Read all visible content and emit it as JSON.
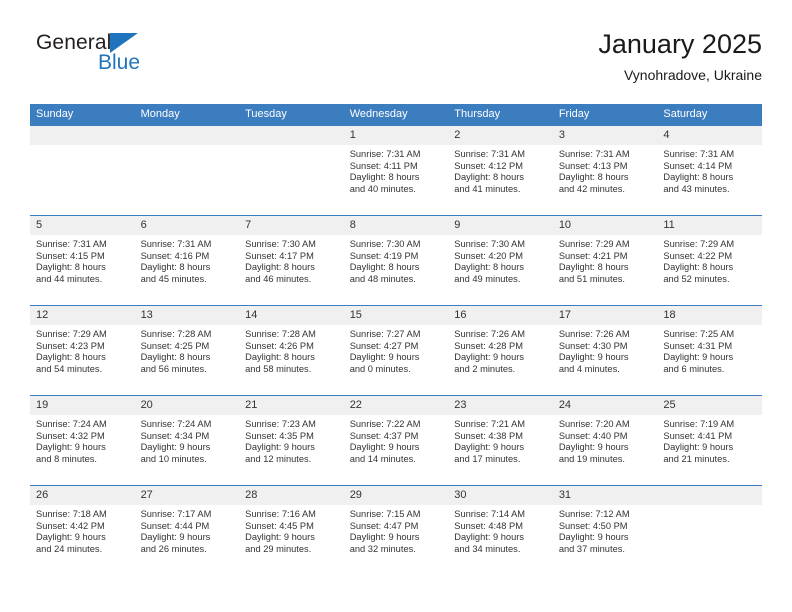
{
  "brand": {
    "name_top": "General",
    "name_bottom": "Blue",
    "triangle_color": "#1f74bd",
    "logo_icon": "general-blue-logo"
  },
  "header": {
    "title": "January 2025",
    "subtitle": "Vynohradove, Ukraine"
  },
  "theme": {
    "header_bg": "#3c7dc0",
    "header_text": "#ffffff",
    "daynum_bg": "#f0f0f0",
    "cell_bg": "#ffffff",
    "rule_color": "#3c7dc0",
    "body_text": "#333333"
  },
  "weekdays": [
    "Sunday",
    "Monday",
    "Tuesday",
    "Wednesday",
    "Thursday",
    "Friday",
    "Saturday"
  ],
  "labels": {
    "sunrise_prefix": "Sunrise:",
    "sunset_prefix": "Sunset:",
    "daylight_prefix": "Daylight:"
  },
  "weeks": [
    [
      {
        "blank": true
      },
      {
        "blank": true
      },
      {
        "blank": true
      },
      {
        "day": "1",
        "sunrise": "Sunrise: 7:31 AM",
        "sunset": "Sunset: 4:11 PM",
        "daylight1": "Daylight: 8 hours",
        "daylight2": "and 40 minutes."
      },
      {
        "day": "2",
        "sunrise": "Sunrise: 7:31 AM",
        "sunset": "Sunset: 4:12 PM",
        "daylight1": "Daylight: 8 hours",
        "daylight2": "and 41 minutes."
      },
      {
        "day": "3",
        "sunrise": "Sunrise: 7:31 AM",
        "sunset": "Sunset: 4:13 PM",
        "daylight1": "Daylight: 8 hours",
        "daylight2": "and 42 minutes."
      },
      {
        "day": "4",
        "sunrise": "Sunrise: 7:31 AM",
        "sunset": "Sunset: 4:14 PM",
        "daylight1": "Daylight: 8 hours",
        "daylight2": "and 43 minutes."
      }
    ],
    [
      {
        "day": "5",
        "sunrise": "Sunrise: 7:31 AM",
        "sunset": "Sunset: 4:15 PM",
        "daylight1": "Daylight: 8 hours",
        "daylight2": "and 44 minutes."
      },
      {
        "day": "6",
        "sunrise": "Sunrise: 7:31 AM",
        "sunset": "Sunset: 4:16 PM",
        "daylight1": "Daylight: 8 hours",
        "daylight2": "and 45 minutes."
      },
      {
        "day": "7",
        "sunrise": "Sunrise: 7:30 AM",
        "sunset": "Sunset: 4:17 PM",
        "daylight1": "Daylight: 8 hours",
        "daylight2": "and 46 minutes."
      },
      {
        "day": "8",
        "sunrise": "Sunrise: 7:30 AM",
        "sunset": "Sunset: 4:19 PM",
        "daylight1": "Daylight: 8 hours",
        "daylight2": "and 48 minutes."
      },
      {
        "day": "9",
        "sunrise": "Sunrise: 7:30 AM",
        "sunset": "Sunset: 4:20 PM",
        "daylight1": "Daylight: 8 hours",
        "daylight2": "and 49 minutes."
      },
      {
        "day": "10",
        "sunrise": "Sunrise: 7:29 AM",
        "sunset": "Sunset: 4:21 PM",
        "daylight1": "Daylight: 8 hours",
        "daylight2": "and 51 minutes."
      },
      {
        "day": "11",
        "sunrise": "Sunrise: 7:29 AM",
        "sunset": "Sunset: 4:22 PM",
        "daylight1": "Daylight: 8 hours",
        "daylight2": "and 52 minutes."
      }
    ],
    [
      {
        "day": "12",
        "sunrise": "Sunrise: 7:29 AM",
        "sunset": "Sunset: 4:23 PM",
        "daylight1": "Daylight: 8 hours",
        "daylight2": "and 54 minutes."
      },
      {
        "day": "13",
        "sunrise": "Sunrise: 7:28 AM",
        "sunset": "Sunset: 4:25 PM",
        "daylight1": "Daylight: 8 hours",
        "daylight2": "and 56 minutes."
      },
      {
        "day": "14",
        "sunrise": "Sunrise: 7:28 AM",
        "sunset": "Sunset: 4:26 PM",
        "daylight1": "Daylight: 8 hours",
        "daylight2": "and 58 minutes."
      },
      {
        "day": "15",
        "sunrise": "Sunrise: 7:27 AM",
        "sunset": "Sunset: 4:27 PM",
        "daylight1": "Daylight: 9 hours",
        "daylight2": "and 0 minutes."
      },
      {
        "day": "16",
        "sunrise": "Sunrise: 7:26 AM",
        "sunset": "Sunset: 4:28 PM",
        "daylight1": "Daylight: 9 hours",
        "daylight2": "and 2 minutes."
      },
      {
        "day": "17",
        "sunrise": "Sunrise: 7:26 AM",
        "sunset": "Sunset: 4:30 PM",
        "daylight1": "Daylight: 9 hours",
        "daylight2": "and 4 minutes."
      },
      {
        "day": "18",
        "sunrise": "Sunrise: 7:25 AM",
        "sunset": "Sunset: 4:31 PM",
        "daylight1": "Daylight: 9 hours",
        "daylight2": "and 6 minutes."
      }
    ],
    [
      {
        "day": "19",
        "sunrise": "Sunrise: 7:24 AM",
        "sunset": "Sunset: 4:32 PM",
        "daylight1": "Daylight: 9 hours",
        "daylight2": "and 8 minutes."
      },
      {
        "day": "20",
        "sunrise": "Sunrise: 7:24 AM",
        "sunset": "Sunset: 4:34 PM",
        "daylight1": "Daylight: 9 hours",
        "daylight2": "and 10 minutes."
      },
      {
        "day": "21",
        "sunrise": "Sunrise: 7:23 AM",
        "sunset": "Sunset: 4:35 PM",
        "daylight1": "Daylight: 9 hours",
        "daylight2": "and 12 minutes."
      },
      {
        "day": "22",
        "sunrise": "Sunrise: 7:22 AM",
        "sunset": "Sunset: 4:37 PM",
        "daylight1": "Daylight: 9 hours",
        "daylight2": "and 14 minutes."
      },
      {
        "day": "23",
        "sunrise": "Sunrise: 7:21 AM",
        "sunset": "Sunset: 4:38 PM",
        "daylight1": "Daylight: 9 hours",
        "daylight2": "and 17 minutes."
      },
      {
        "day": "24",
        "sunrise": "Sunrise: 7:20 AM",
        "sunset": "Sunset: 4:40 PM",
        "daylight1": "Daylight: 9 hours",
        "daylight2": "and 19 minutes."
      },
      {
        "day": "25",
        "sunrise": "Sunrise: 7:19 AM",
        "sunset": "Sunset: 4:41 PM",
        "daylight1": "Daylight: 9 hours",
        "daylight2": "and 21 minutes."
      }
    ],
    [
      {
        "day": "26",
        "sunrise": "Sunrise: 7:18 AM",
        "sunset": "Sunset: 4:42 PM",
        "daylight1": "Daylight: 9 hours",
        "daylight2": "and 24 minutes."
      },
      {
        "day": "27",
        "sunrise": "Sunrise: 7:17 AM",
        "sunset": "Sunset: 4:44 PM",
        "daylight1": "Daylight: 9 hours",
        "daylight2": "and 26 minutes."
      },
      {
        "day": "28",
        "sunrise": "Sunrise: 7:16 AM",
        "sunset": "Sunset: 4:45 PM",
        "daylight1": "Daylight: 9 hours",
        "daylight2": "and 29 minutes."
      },
      {
        "day": "29",
        "sunrise": "Sunrise: 7:15 AM",
        "sunset": "Sunset: 4:47 PM",
        "daylight1": "Daylight: 9 hours",
        "daylight2": "and 32 minutes."
      },
      {
        "day": "30",
        "sunrise": "Sunrise: 7:14 AM",
        "sunset": "Sunset: 4:48 PM",
        "daylight1": "Daylight: 9 hours",
        "daylight2": "and 34 minutes."
      },
      {
        "day": "31",
        "sunrise": "Sunrise: 7:12 AM",
        "sunset": "Sunset: 4:50 PM",
        "daylight1": "Daylight: 9 hours",
        "daylight2": "and 37 minutes."
      },
      {
        "blank": true
      }
    ]
  ]
}
